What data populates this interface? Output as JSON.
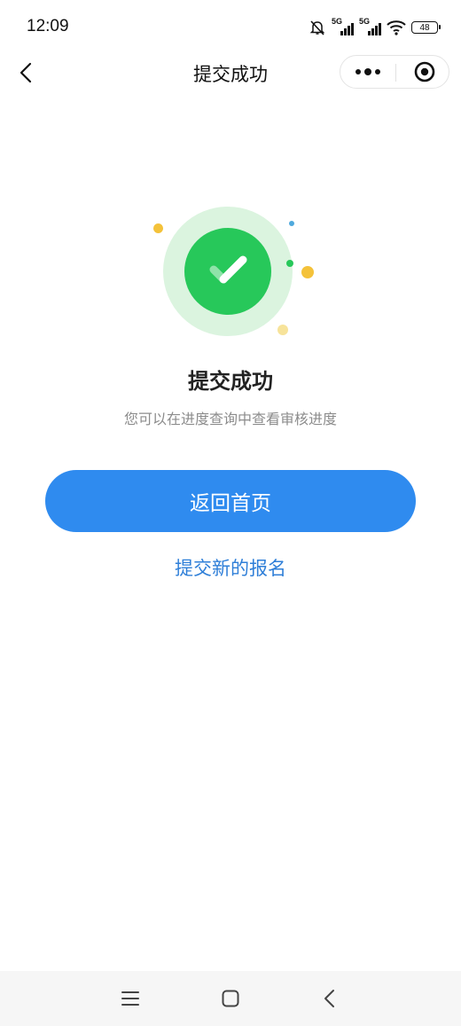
{
  "status_bar": {
    "time": "12:09",
    "signal_1_label": "5G",
    "signal_2_label": "5G",
    "battery": "48"
  },
  "nav": {
    "title": "提交成功"
  },
  "result": {
    "title": "提交成功",
    "subtitle": "您可以在进度查询中查看审核进度"
  },
  "actions": {
    "primary_label": "返回首页",
    "secondary_label": "提交新的报名"
  },
  "colors": {
    "accent": "#2f8bef",
    "success": "#27c85a",
    "link": "#2f7fd8"
  },
  "icons": [
    "mute-bell-icon",
    "signal-icon",
    "wifi-icon",
    "battery-icon",
    "back-arrow-icon",
    "more-dots-icon",
    "close-target-icon",
    "checkmark-icon",
    "menu-icon",
    "home-icon",
    "system-back-icon"
  ]
}
